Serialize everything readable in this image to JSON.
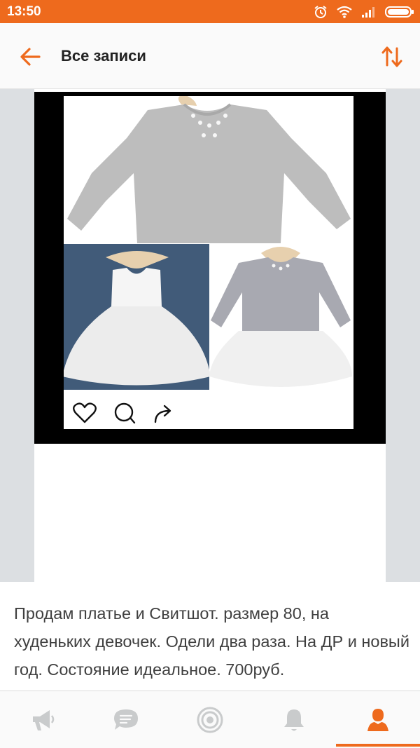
{
  "status_bar": {
    "time": "13:50"
  },
  "app_bar": {
    "title": "Все записи"
  },
  "post": {
    "description": "Продам платье и Свитшот. размер 80, на худеньких девочек. Одели два раза. На ДР и новый год. Состояние идеальное. 700руб."
  },
  "colors": {
    "accent": "#ee6a1d",
    "nav_inactive": "#c9cbcc",
    "page_bg": "#dcdfe2"
  },
  "bottom_nav": {
    "items": [
      {
        "icon": "megaphone-icon",
        "active": false
      },
      {
        "icon": "chat-bubble-icon",
        "active": false
      },
      {
        "icon": "target-icon",
        "active": false
      },
      {
        "icon": "bell-icon",
        "active": false
      },
      {
        "icon": "profile-icon",
        "active": true
      }
    ]
  }
}
